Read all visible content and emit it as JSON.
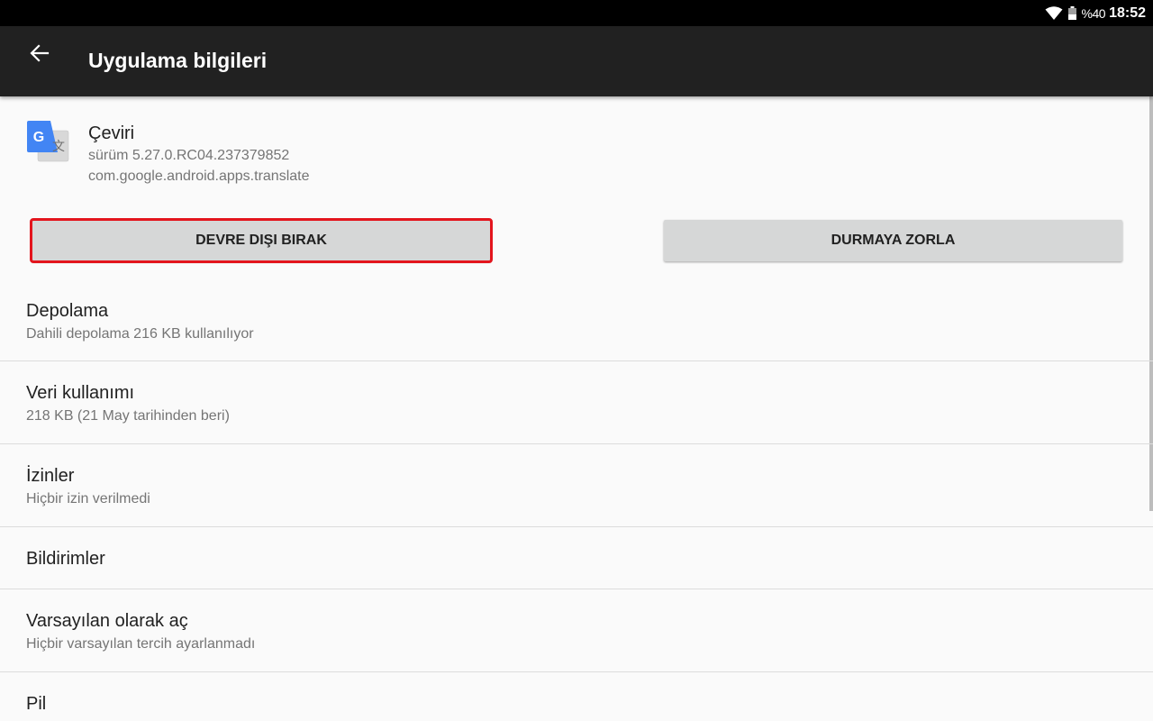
{
  "status_bar": {
    "battery": "%40",
    "time": "18:52"
  },
  "toolbar": {
    "title": "Uygulama bilgileri",
    "back_icon": "arrow-back-icon"
  },
  "app": {
    "name": "Çeviri",
    "version": "sürüm 5.27.0.RC04.237379852",
    "package": "com.google.android.apps.translate",
    "icon": "google-translate-icon"
  },
  "actions": {
    "disable_label": "DEVRE DIŞI BIRAK",
    "force_stop_label": "DURMAYA ZORLA"
  },
  "prefs": [
    {
      "title": "Depolama",
      "summary": "Dahili depolama 216 KB kullanılıyor"
    },
    {
      "title": "Veri kullanımı",
      "summary": "218 KB (21 May tarihinden beri)"
    },
    {
      "title": "İzinler",
      "summary": "Hiçbir izin verilmedi"
    },
    {
      "title": "Bildirimler",
      "summary": ""
    },
    {
      "title": "Varsayılan olarak aç",
      "summary": "Hiçbir varsayılan tercih ayarlanmadı"
    },
    {
      "title": "Pil",
      "summary": ""
    }
  ],
  "colors": {
    "status_bar": "#000000",
    "toolbar": "#212121",
    "background": "#fafafa",
    "button": "#d6d7d7",
    "highlight": "#e3151d"
  }
}
